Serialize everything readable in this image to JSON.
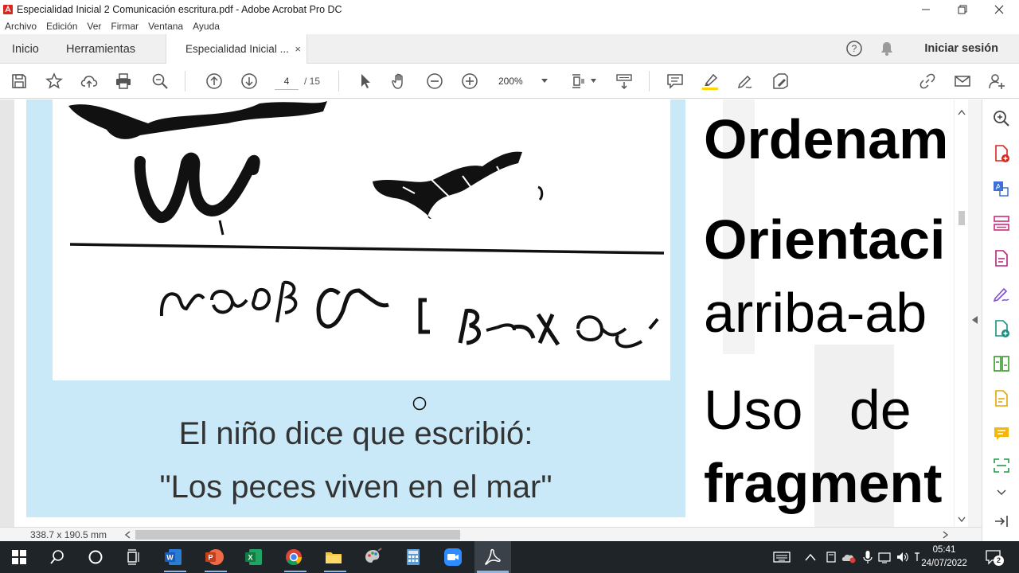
{
  "window": {
    "title": "Especialidad Inicial 2 Comunicación escritura.pdf - Adobe Acrobat Pro DC"
  },
  "menu": [
    "Archivo",
    "Edición",
    "Ver",
    "Firmar",
    "Ventana",
    "Ayuda"
  ],
  "tabs": {
    "home": "Inicio",
    "tools": "Herramientas",
    "document": "Especialidad Inicial ...",
    "close": "×"
  },
  "header": {
    "signin": "Iniciar sesión"
  },
  "toolbar": {
    "page_current": "4",
    "page_total": "/ 15",
    "zoom": "200%"
  },
  "document": {
    "caption_line1": "El niño dice que escribió:",
    "caption_line2": "\"Los peces viven en el mar\"",
    "right_text": [
      "Ordenam",
      "Orientaci",
      "arriba-ab",
      "Uso   de",
      "fragment"
    ],
    "panel_color": "#c9e9f8"
  },
  "status": {
    "dimensions": "338.7 x 190.5 mm"
  },
  "taskbar": {
    "time": "05:41",
    "date": "24/07/2022",
    "notification_count": "2"
  },
  "colors": {
    "acrobat_red": "#d9261c",
    "highlighter_yellow": "#ffd600",
    "taskbar": "#1f2428"
  }
}
